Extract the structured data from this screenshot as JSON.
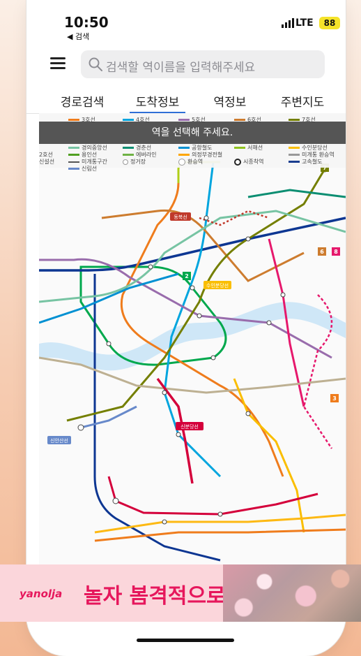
{
  "status_bar": {
    "time": "10:50",
    "back_app": "◀ 검색",
    "network": "LTE",
    "battery": "88"
  },
  "search": {
    "placeholder": "검색할 역이름을 입력해주세요"
  },
  "tabs": [
    {
      "label": "경로검색",
      "active": false
    },
    {
      "label": "도착정보",
      "active": true
    },
    {
      "label": "역정보",
      "active": false
    },
    {
      "label": "주변지도",
      "active": false
    }
  ],
  "map": {
    "toast": "역을 선택해 주세요.",
    "legend": [
      {
        "label": "3호선",
        "color": "#ef7c1c"
      },
      {
        "label": "4호선",
        "color": "#00a5de"
      },
      {
        "label": "5호선",
        "color": "#996cac"
      },
      {
        "label": "6호선",
        "color": "#cd7c2f"
      },
      {
        "label": "7호선",
        "color": "#747f00"
      },
      {
        "label": "경의중앙선",
        "color": "#77c4a3"
      },
      {
        "label": "경춘선",
        "color": "#0c8e72"
      },
      {
        "label": "공항철도",
        "color": "#0090d2"
      },
      {
        "label": "서해선",
        "color": "#8fc31f"
      },
      {
        "label": "수인분당선",
        "color": "#fabe00"
      },
      {
        "label": "2호선",
        "color": "#00a84d"
      },
      {
        "label": "용인선",
        "color": "#509f22"
      },
      {
        "label": "에버라인",
        "color": "#6fb245"
      },
      {
        "label": "의정부경전철",
        "color": "#fda600"
      },
      {
        "label": "신설선",
        "color": "#b0ce18"
      },
      {
        "label": "미개통구간",
        "color": "#555555"
      },
      {
        "label": "정거장",
        "color": "#ffffff"
      },
      {
        "label": "환승역",
        "color": "#ffffff"
      },
      {
        "label": "시종착역",
        "color": "#222222"
      },
      {
        "label": "고속철도",
        "color": "#1a3d8f"
      },
      {
        "label": "신림선",
        "color": "#6789ca"
      },
      {
        "label": "미개통 환승역",
        "color": "#999999"
      }
    ],
    "line_badges": [
      "7",
      "2",
      "6",
      "8",
      "3"
    ],
    "line_names": [
      "신분당선",
      "수인분당선",
      "동북선",
      "신안산선"
    ],
    "zoom_in": "+",
    "zoom_out": "−"
  },
  "ad": {
    "brand": "yanolja",
    "text": "놀자 봄격적으로"
  },
  "colors": {
    "accent": "#2f6fd6",
    "ad_pink": "#e6175c",
    "toast_bg": "#282828"
  }
}
